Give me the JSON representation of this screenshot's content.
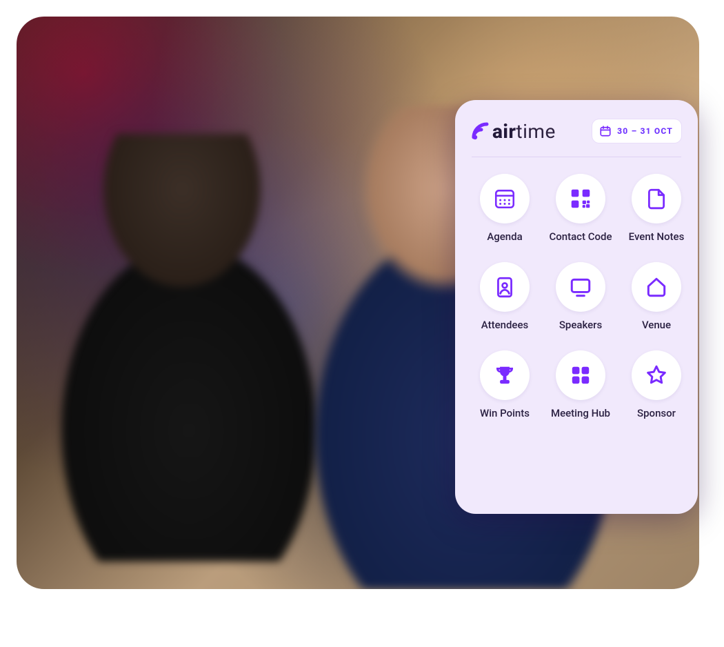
{
  "brand": {
    "name_bold": "air",
    "name_rest": "time",
    "accent_color": "#7a2bff",
    "text_color": "#2d2240",
    "card_bg": "#f1e9fc"
  },
  "header": {
    "date_label": "30 – 31  OCT",
    "date_icon": "calendar-icon"
  },
  "tiles": [
    {
      "id": "agenda",
      "label": "Agenda",
      "icon": "calendar-grid-icon"
    },
    {
      "id": "contact-code",
      "label": "Contact Code",
      "icon": "qr-icon"
    },
    {
      "id": "event-notes",
      "label": "Event Notes",
      "icon": "document-icon"
    },
    {
      "id": "attendees",
      "label": "Attendees",
      "icon": "badge-person-icon"
    },
    {
      "id": "speakers",
      "label": "Speakers",
      "icon": "monitor-icon"
    },
    {
      "id": "venue",
      "label": "Venue",
      "icon": "home-icon"
    },
    {
      "id": "win-points",
      "label": "Win Points",
      "icon": "trophy-icon"
    },
    {
      "id": "meeting-hub",
      "label": "Meeting Hub",
      "icon": "apps-grid-icon"
    },
    {
      "id": "sponsor",
      "label": "Sponsor",
      "icon": "star-icon"
    }
  ]
}
